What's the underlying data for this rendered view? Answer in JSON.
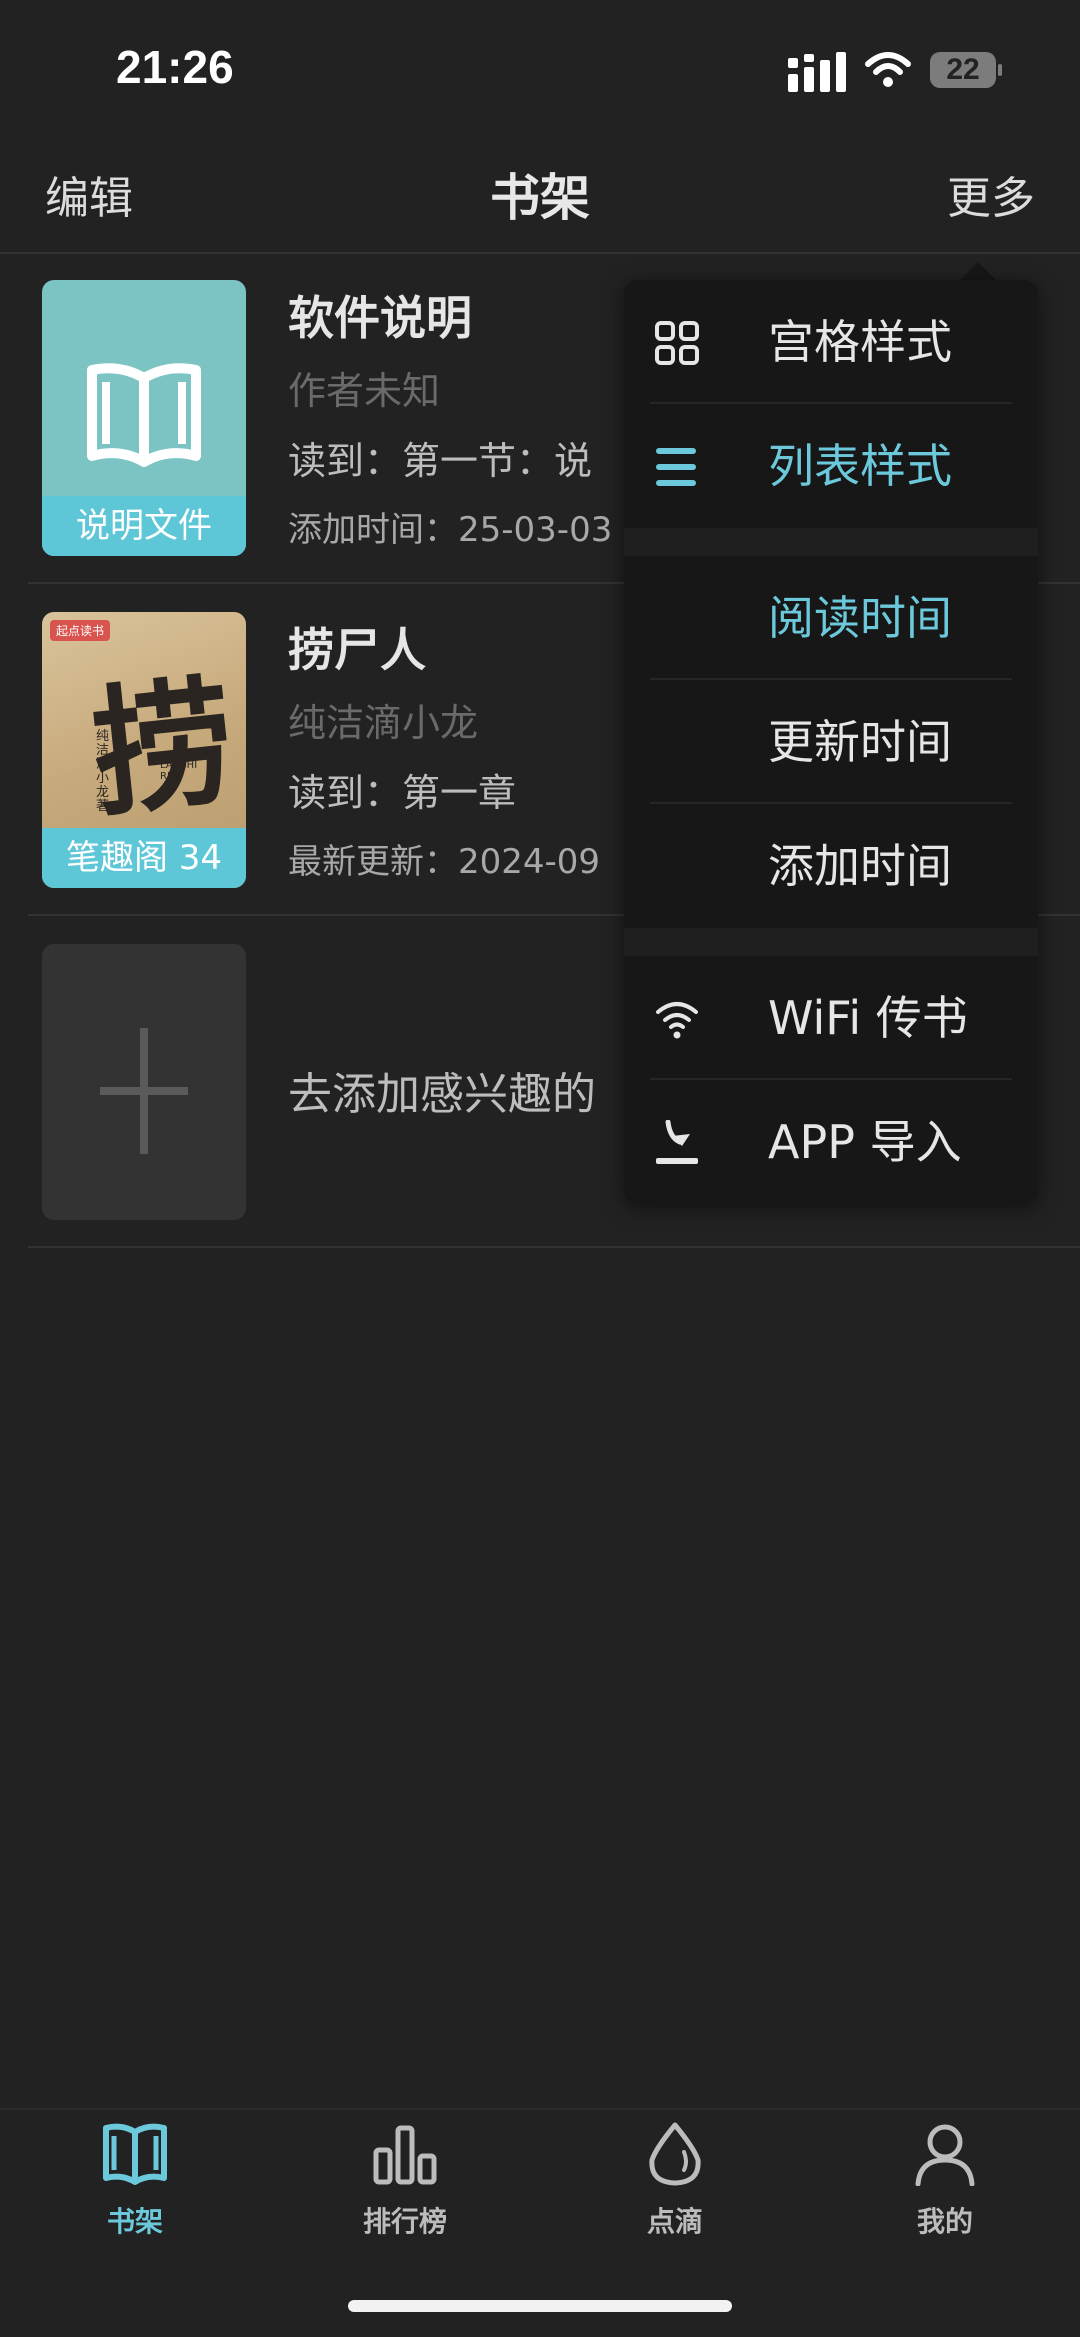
{
  "status_bar": {
    "time": "21:26",
    "battery": "22"
  },
  "nav": {
    "left": "编辑",
    "title": "书架",
    "right": "更多"
  },
  "books": [
    {
      "title": "软件说明",
      "author": "作者未知",
      "progress": "读到：第一节：说",
      "meta": "添加时间：25-03-03",
      "cover_label": "说明文件"
    },
    {
      "title": "捞尸人",
      "author": "纯洁滴小龙",
      "progress": "读到：第一章",
      "meta": "最新更新：2024-09",
      "cover_label": "笔趣阁 34",
      "cover_art": {
        "badge": "起点读书",
        "big": "捞",
        "side": "纯洁滴小龙 著",
        "small": "LAOSHI REN"
      }
    }
  ],
  "add_prompt": "去添加感兴趣的",
  "menu": {
    "layout": [
      "宫格样式",
      "列表样式"
    ],
    "sort": [
      "阅读时间",
      "更新时间",
      "添加时间"
    ],
    "import": [
      "WiFi 传书",
      "APP 导入"
    ]
  },
  "tabs": [
    "书架",
    "排行榜",
    "点滴",
    "我的"
  ],
  "colors": {
    "accent": "#6cc9dc",
    "cover_teal": "#7cc4c4",
    "background": "#222222"
  }
}
